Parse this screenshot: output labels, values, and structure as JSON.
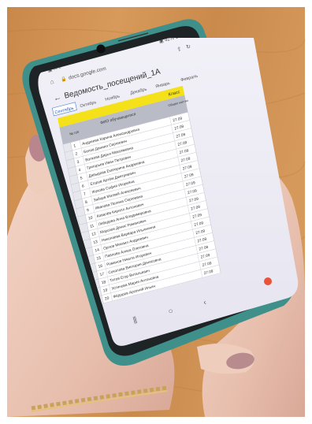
{
  "status_bar": {
    "left_icons": "▣ ✉ ≡",
    "right_text": "▣ 42% 17:14"
  },
  "browser": {
    "url": "docs.google.com",
    "icons": [
      "home-icon",
      "lock-icon",
      "share-icon",
      "refresh-icon"
    ]
  },
  "document": {
    "title": "Ведомость_посещений_1А",
    "icons": [
      "back-arrow-icon"
    ]
  },
  "sheet_tabs": [
    {
      "label": "Сентябрь",
      "active": true
    },
    {
      "label": "Октябрь",
      "active": false
    },
    {
      "label": "Ноябрь",
      "active": false
    },
    {
      "label": "Декабрь",
      "active": false
    },
    {
      "label": "Январь",
      "active": false
    },
    {
      "label": "Февраль",
      "active": false
    }
  ],
  "sheet": {
    "class_label": "Класс",
    "header_number": "№ п/п",
    "header_name": "ФИО обучающегося",
    "header_date": "Общее кол-во",
    "accent_color": "#f5e11a",
    "header_color": "#b9bcc6",
    "rows": [
      {
        "n": "1",
        "name": "Андреева Карина Александровна",
        "date": "27.09"
      },
      {
        "n": "2",
        "name": "Белов Даниил Сергеевич",
        "date": "27.09"
      },
      {
        "n": "3",
        "name": "Волкова Дарья Максимовна",
        "date": "27.09"
      },
      {
        "n": "4",
        "name": "Григорьев Иван Петрович",
        "date": "27.09"
      },
      {
        "n": "5",
        "name": "Давыдова Екатерина Андреевна",
        "date": "27.09"
      },
      {
        "n": "6",
        "name": "Егоров Артём Дмитриевич",
        "date": "27.09"
      },
      {
        "n": "7",
        "name": "Жукова София Игоревна",
        "date": "27.09"
      },
      {
        "n": "8",
        "name": "Зайцев Матвей Алексеевич",
        "date": "27.09"
      },
      {
        "n": "9",
        "name": "Иванова Полина Сергеевна",
        "date": "27.09"
      },
      {
        "n": "10",
        "name": "Ковалёв Кирилл Антонович",
        "date": "27.09"
      },
      {
        "n": "11",
        "name": "Лебедева Анна Владимировна",
        "date": "27.09"
      },
      {
        "n": "12",
        "name": "Морозов Денис Романович",
        "date": "27.09"
      },
      {
        "n": "13",
        "name": "Николаева Варвара Ильинична",
        "date": "27.09"
      },
      {
        "n": "14",
        "name": "Орлов Михаил Андреевич",
        "date": "27.09"
      },
      {
        "n": "15",
        "name": "Павлова Алиса Олеговна",
        "date": "27.09"
      },
      {
        "n": "16",
        "name": "Романов Никита Игоревич",
        "date": "27.09"
      },
      {
        "n": "17",
        "name": "Соколова Виктория Денисовна",
        "date": "27.09"
      },
      {
        "n": "18",
        "name": "Титов Егор Витальевич",
        "date": "27.09"
      },
      {
        "n": "19",
        "name": "Устинова Мария Антоновна",
        "date": "27.09"
      },
      {
        "n": "20",
        "name": "Фёдоров Арсений Ильич",
        "date": "27.09"
      }
    ]
  },
  "nav_bar": {
    "icons": [
      "menu-icon",
      "home-nav-icon",
      "back-nav-icon"
    ]
  },
  "fab_color": "#e8533a"
}
